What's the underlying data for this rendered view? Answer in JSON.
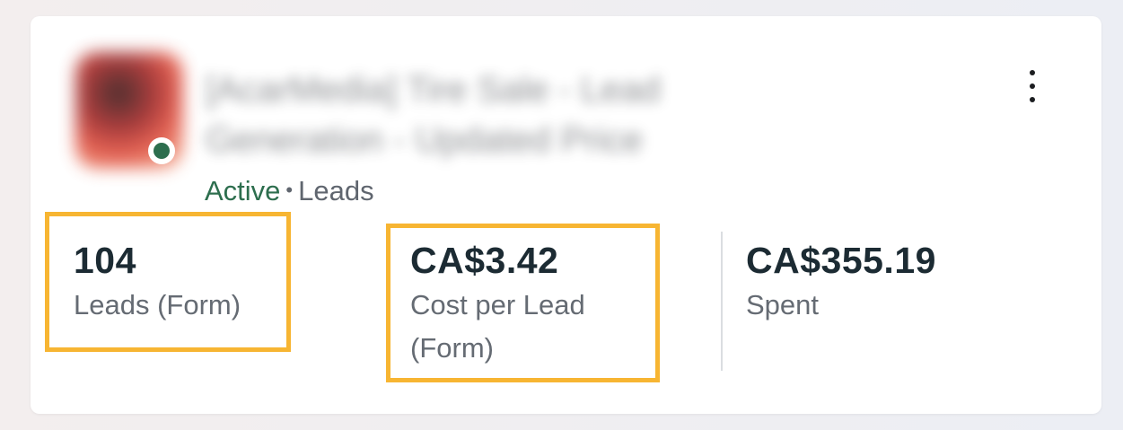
{
  "campaign": {
    "name": "[AcarMedia] Tire Sale - Lead Generation - Updated Price",
    "status": "Active",
    "separator": "•",
    "objective": "Leads"
  },
  "metrics": [
    {
      "value": "104",
      "label": "Leads (Form)"
    },
    {
      "value": "CA$3.42",
      "label_line1": "Cost per Lead",
      "label_line2": "(Form)"
    },
    {
      "value": "CA$355.19",
      "label": "Spent"
    }
  ],
  "colors": {
    "active_status": "#2d6e4e",
    "highlight": "#f7b532"
  },
  "icons": {
    "more": "more-vertical-icon"
  }
}
